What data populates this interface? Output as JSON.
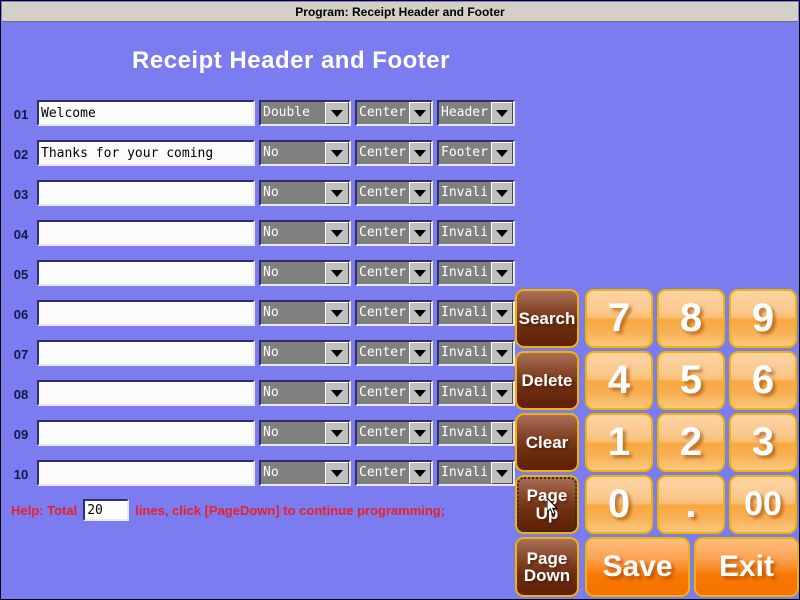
{
  "window": {
    "title": "Program: Receipt Header and Footer"
  },
  "page": {
    "heading": "Receipt Header and Footer"
  },
  "colors": {
    "background": "#7b7cf0",
    "titlebar": "#d4d0c8",
    "help_text": "#e8202a",
    "dropdown_bg": "#808080",
    "button_orange": "#f8a73f",
    "button_brown": "#7a3a1c",
    "button_border": "#f0b400",
    "row_label": "#16164a"
  },
  "rows": [
    {
      "no": "01",
      "text": "Welcome",
      "size": "Double ",
      "align": "Center",
      "type": "Header"
    },
    {
      "no": "02",
      "text": "Thanks for your coming",
      "size": "No",
      "align": "Center",
      "type": "Footer"
    },
    {
      "no": "03",
      "text": "",
      "size": "No",
      "align": "Center",
      "type": "Invali"
    },
    {
      "no": "04",
      "text": "",
      "size": "No",
      "align": "Center",
      "type": "Invali"
    },
    {
      "no": "05",
      "text": "",
      "size": "No",
      "align": "Center",
      "type": "Invali"
    },
    {
      "no": "06",
      "text": "",
      "size": "No",
      "align": "Center",
      "type": "Invali"
    },
    {
      "no": "07",
      "text": "",
      "size": "No",
      "align": "Center",
      "type": "Invali"
    },
    {
      "no": "08",
      "text": "",
      "size": "No",
      "align": "Center",
      "type": "Invali"
    },
    {
      "no": "09",
      "text": "",
      "size": "No",
      "align": "Center",
      "type": "Invali"
    },
    {
      "no": "10",
      "text": "",
      "size": "No",
      "align": "Center",
      "type": "Invali"
    }
  ],
  "help": {
    "prefix": "Help: Total",
    "total_lines": "20",
    "suffix": "lines, click [PageDown] to continue programming;"
  },
  "keypad": {
    "commands": [
      {
        "id": "search",
        "label": "Search",
        "focused": false
      },
      {
        "id": "delete",
        "label": "Delete",
        "focused": false
      },
      {
        "id": "clear",
        "label": "Clear",
        "focused": false
      },
      {
        "id": "page-up",
        "label": "Page Up",
        "focused": true
      }
    ],
    "page_down": {
      "line1": "Page",
      "line2": "Down"
    },
    "numbers": [
      {
        "id": "key-7",
        "label": "7"
      },
      {
        "id": "key-8",
        "label": "8"
      },
      {
        "id": "key-9",
        "label": "9"
      },
      {
        "id": "key-4",
        "label": "4"
      },
      {
        "id": "key-5",
        "label": "5"
      },
      {
        "id": "key-6",
        "label": "6"
      },
      {
        "id": "key-1",
        "label": "1"
      },
      {
        "id": "key-2",
        "label": "2"
      },
      {
        "id": "key-3",
        "label": "3"
      },
      {
        "id": "key-0",
        "label": "0"
      },
      {
        "id": "key-dot",
        "label": "."
      },
      {
        "id": "key-00",
        "label": "00"
      }
    ],
    "save_label": "Save",
    "exit_label": "Exit"
  },
  "icons": {
    "dropdown_arrow": "chevron-down-icon",
    "mouse_pointer": "mouse-cursor-icon"
  }
}
